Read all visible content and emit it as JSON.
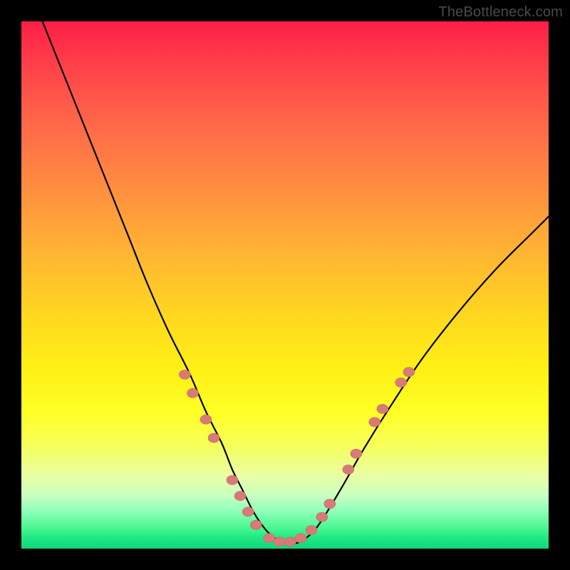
{
  "watermark": "TheBottleneck.com",
  "colors": {
    "curve": "#000000",
    "dot_fill": "#d87a78",
    "dot_stroke": "#c96763"
  },
  "chart_data": {
    "type": "line",
    "title": "",
    "xlabel": "",
    "ylabel": "",
    "xlim": [
      0,
      100
    ],
    "ylim": [
      0,
      100
    ],
    "note": "No axis ticks or numeric labels are rendered in the image; values below are positional estimates (0–100 plot-coordinate space, y measured from bottom).",
    "series": [
      {
        "name": "bottleneck-curve",
        "x": [
          4,
          8,
          12,
          16,
          20,
          24,
          28,
          32,
          35,
          38,
          40,
          42,
          44,
          46,
          48,
          50,
          52,
          54,
          56,
          58,
          61,
          65,
          70,
          76,
          83,
          90,
          97,
          100
        ],
        "y": [
          100,
          90,
          80,
          70,
          60,
          50,
          41,
          33,
          26,
          20,
          15,
          11,
          7,
          4,
          2,
          1,
          1,
          2,
          4,
          7,
          12,
          19,
          27,
          36,
          45,
          53,
          60,
          63
        ]
      }
    ],
    "markers": [
      {
        "x": 31.0,
        "y": 33.0
      },
      {
        "x": 32.5,
        "y": 29.5
      },
      {
        "x": 35.0,
        "y": 24.5
      },
      {
        "x": 36.5,
        "y": 21.0
      },
      {
        "x": 40.0,
        "y": 13.0
      },
      {
        "x": 41.5,
        "y": 10.0
      },
      {
        "x": 43.0,
        "y": 7.0
      },
      {
        "x": 44.5,
        "y": 4.5
      },
      {
        "x": 47.0,
        "y": 2.0
      },
      {
        "x": 49.0,
        "y": 1.3
      },
      {
        "x": 51.0,
        "y": 1.3
      },
      {
        "x": 53.0,
        "y": 2.0
      },
      {
        "x": 55.0,
        "y": 3.5
      },
      {
        "x": 57.0,
        "y": 6.0
      },
      {
        "x": 58.5,
        "y": 8.5
      },
      {
        "x": 62.0,
        "y": 15.0
      },
      {
        "x": 63.5,
        "y": 18.0
      },
      {
        "x": 67.0,
        "y": 24.0
      },
      {
        "x": 68.5,
        "y": 26.5
      },
      {
        "x": 72.0,
        "y": 31.5
      },
      {
        "x": 73.5,
        "y": 33.5
      }
    ],
    "marker_radius_px": 8
  }
}
